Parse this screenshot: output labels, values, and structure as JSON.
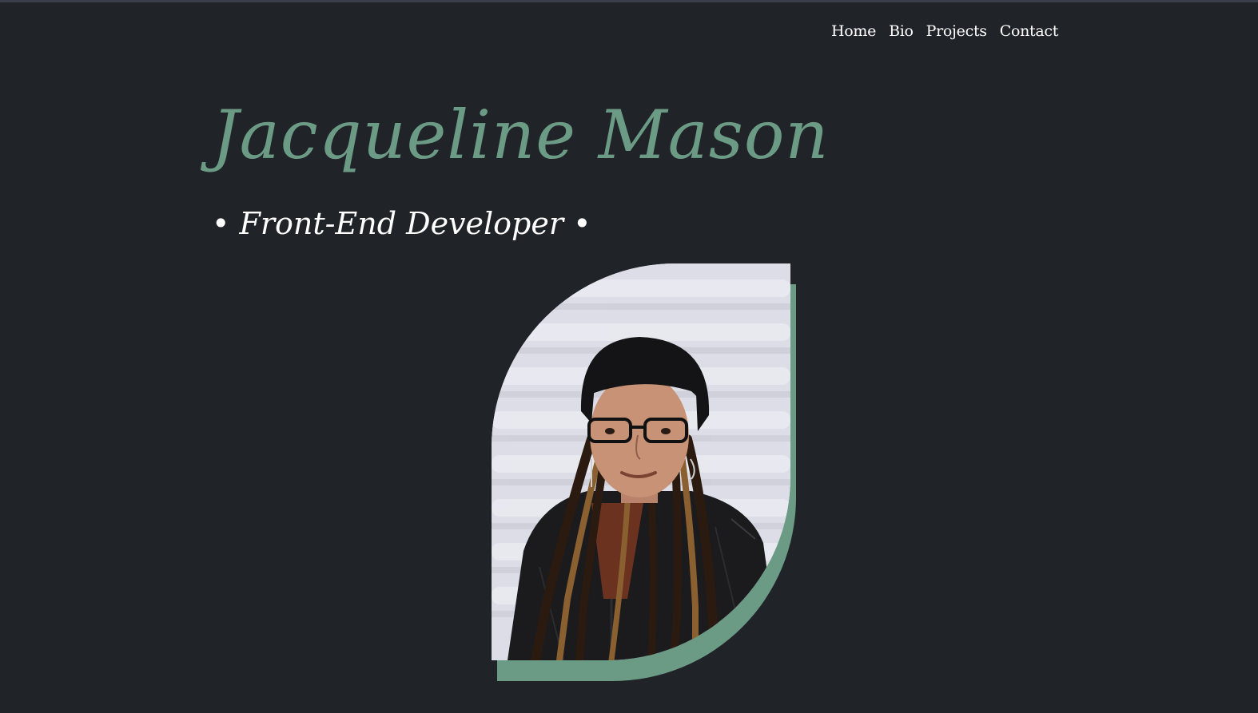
{
  "nav": {
    "items": [
      "Home",
      "Bio",
      "Projects",
      "Contact"
    ]
  },
  "hero": {
    "name": "Jacqueline Mason",
    "role": "• Front-End Developer •"
  },
  "portrait": {
    "alt": "Portrait of Jacqueline Mason"
  },
  "colors": {
    "background": "#202328",
    "accent": "#6b9a85",
    "text": "#ffffff"
  }
}
